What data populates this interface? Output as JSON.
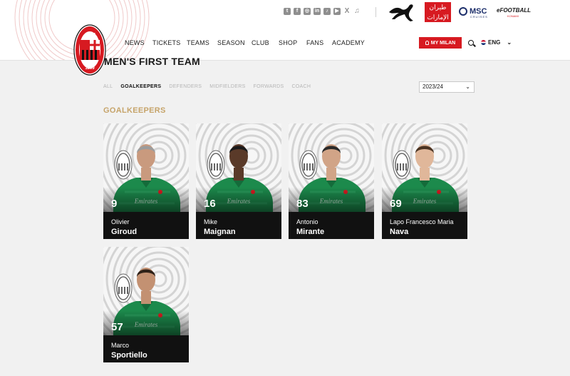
{
  "header": {
    "social_icons": [
      "twitch-icon",
      "facebook-icon",
      "instagram-icon",
      "linkedin-icon",
      "tiktok-icon",
      "youtube-icon",
      "x-icon",
      "music-icon"
    ],
    "sponsors": {
      "emirates_ar": "طيران الإمارات",
      "emirates_en": "Emirates",
      "msc": "MSC",
      "msc_sub": "CRUISES",
      "efootball": "eFOOTBALL",
      "efootball_sub": "KONAMI"
    },
    "crest": {
      "top": "ACM",
      "year": "1899"
    },
    "nav": [
      "NEWS",
      "TICKETS",
      "TEAMS",
      "SEASON",
      "CLUB",
      "SHOP",
      "FANS",
      "ACADEMY"
    ],
    "mymilan": "MY MILAN",
    "language": "ENG"
  },
  "main": {
    "title": "MEN'S FIRST TEAM",
    "filters": [
      {
        "label": "ALL",
        "active": false
      },
      {
        "label": "GOALKEEPERS",
        "active": true
      },
      {
        "label": "DEFENDERS",
        "active": false
      },
      {
        "label": "MIDFIELDERS",
        "active": false
      },
      {
        "label": "FORWARDS",
        "active": false
      },
      {
        "label": "COACH",
        "active": false
      }
    ],
    "season": "2023/24",
    "section": "GOALKEEPERS",
    "jersey_text": "Emirates",
    "players": [
      {
        "number": "9",
        "first": "Olivier",
        "last": "Giroud",
        "skin": "#c99a7e",
        "hair": "#9c9c9c"
      },
      {
        "number": "16",
        "first": "Mike",
        "last": "Maignan",
        "skin": "#5a3a29",
        "hair": "#1a1a1a"
      },
      {
        "number": "83",
        "first": "Antonio",
        "last": "Mirante",
        "skin": "#d1a487",
        "hair": "#2a2a2a"
      },
      {
        "number": "69",
        "first": "Lapo Francesco Maria",
        "last": "Nava",
        "skin": "#e0b79a",
        "hair": "#4a3322"
      },
      {
        "number": "57",
        "first": "Marco",
        "last": "Sportiello",
        "skin": "#c39172",
        "hair": "#2e2118"
      }
    ]
  },
  "colors": {
    "accent_red": "#d71a21",
    "gold": "#c6a46a",
    "kit_green": "#1c8a4c"
  }
}
